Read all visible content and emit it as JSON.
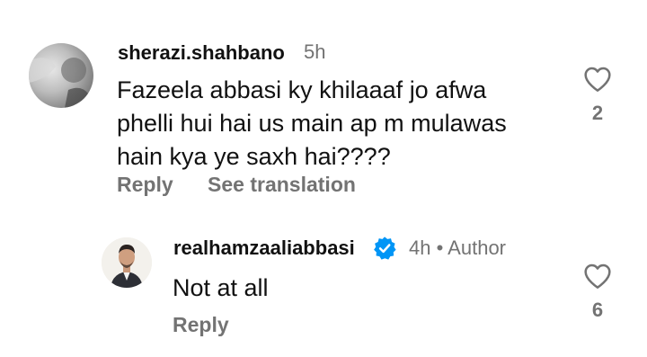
{
  "comment1": {
    "username": "sherazi.shahbano",
    "time": "5h",
    "lines": [
      "Fazeela abbasi ky khilaaaf jo afwa",
      "phelli hui hai us main ap m mulawas",
      "hain kya ye saxh hai????"
    ],
    "reply_label": "Reply",
    "translate_label": "See translation",
    "like_count": "2"
  },
  "reply1": {
    "username": "realhamzaaliabbasi",
    "time": "4h • Author",
    "text": "Not at all",
    "reply_label": "Reply",
    "like_count": "6"
  },
  "colors": {
    "muted": "#737373",
    "verified": "#0095F6"
  },
  "icons": {
    "like": "heart-outline-icon",
    "verified": "verified-badge-icon"
  }
}
